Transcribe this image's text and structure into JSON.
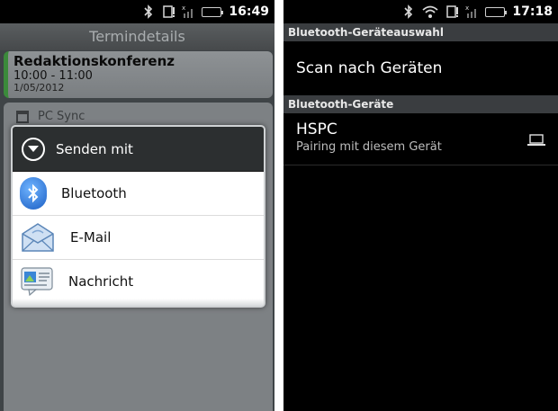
{
  "left_phone": {
    "status_time": "16:49",
    "app_title": "Termindetails",
    "event": {
      "title": "Redaktionskonferenz",
      "time": "10:00 - 11:00",
      "date": "1/05/2012"
    },
    "background_row": "PC Sync",
    "dialog": {
      "title": "Senden mit",
      "items": [
        {
          "label": "Bluetooth",
          "icon": "bluetooth-icon"
        },
        {
          "label": "E-Mail",
          "icon": "email-icon"
        },
        {
          "label": "Nachricht",
          "icon": "message-icon"
        }
      ]
    }
  },
  "right_phone": {
    "status_time": "17:18",
    "section_select": "Bluetooth-Geräteauswahl",
    "scan_label": "Scan nach Geräten",
    "section_devices": "Bluetooth-Geräte",
    "device": {
      "name": "HSPC",
      "status": "Pairing mit diesem Gerät",
      "icon": "laptop-icon"
    }
  },
  "colors": {
    "battery_green": "#35d435",
    "bluetooth_blue": "#1c5fc4",
    "event_accent": "#3b8a3b"
  }
}
